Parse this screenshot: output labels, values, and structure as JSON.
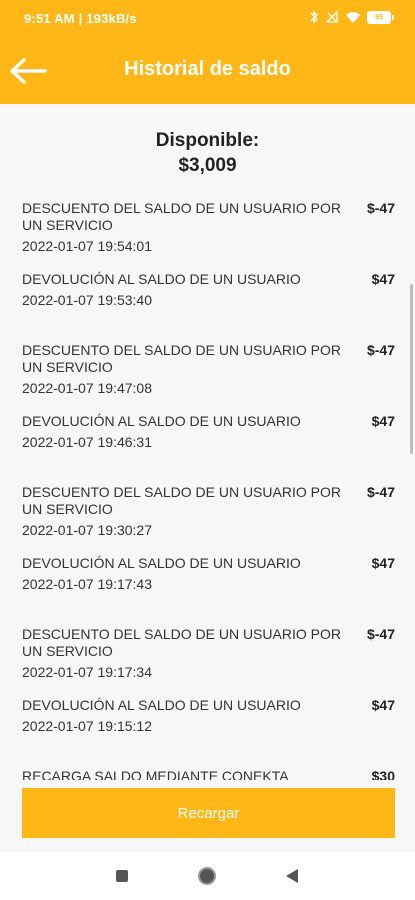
{
  "status": {
    "time": "9:51 AM | 193kB/s",
    "battery": "99"
  },
  "header": {
    "title": "Historial de saldo"
  },
  "balance": {
    "label": "Disponible:",
    "value": "$3,009"
  },
  "transactions": [
    {
      "desc": "DESCUENTO DEL SALDO DE UN USUARIO POR UN SERVICIO",
      "date": "2022-01-07 19:54:01",
      "amount": "$-47"
    },
    {
      "desc": "DEVOLUCIÓN AL SALDO DE UN USUARIO",
      "date": "2022-01-07 19:53:40",
      "amount": "$47"
    },
    {
      "desc": "DESCUENTO DEL SALDO DE UN USUARIO POR UN SERVICIO",
      "date": "2022-01-07 19:47:08",
      "amount": "$-47"
    },
    {
      "desc": "DEVOLUCIÓN AL SALDO DE UN USUARIO",
      "date": "2022-01-07 19:46:31",
      "amount": "$47"
    },
    {
      "desc": "DESCUENTO DEL SALDO DE UN USUARIO POR UN SERVICIO",
      "date": "2022-01-07 19:30:27",
      "amount": "$-47"
    },
    {
      "desc": "DEVOLUCIÓN AL SALDO DE UN USUARIO",
      "date": "2022-01-07 19:17:43",
      "amount": "$47"
    },
    {
      "desc": "DESCUENTO DEL SALDO DE UN USUARIO POR UN SERVICIO",
      "date": "2022-01-07 19:17:34",
      "amount": "$-47"
    },
    {
      "desc": "DEVOLUCIÓN AL SALDO DE UN USUARIO",
      "date": "2022-01-07 19:15:12",
      "amount": "$47"
    },
    {
      "desc": "RECARGA SALDO MEDIANTE CONEKTA",
      "date": "",
      "amount": "$30"
    }
  ],
  "actions": {
    "recharge_label": "Recargar"
  },
  "colors": {
    "accent": "#FFB718",
    "background": "#F7F7F7"
  }
}
